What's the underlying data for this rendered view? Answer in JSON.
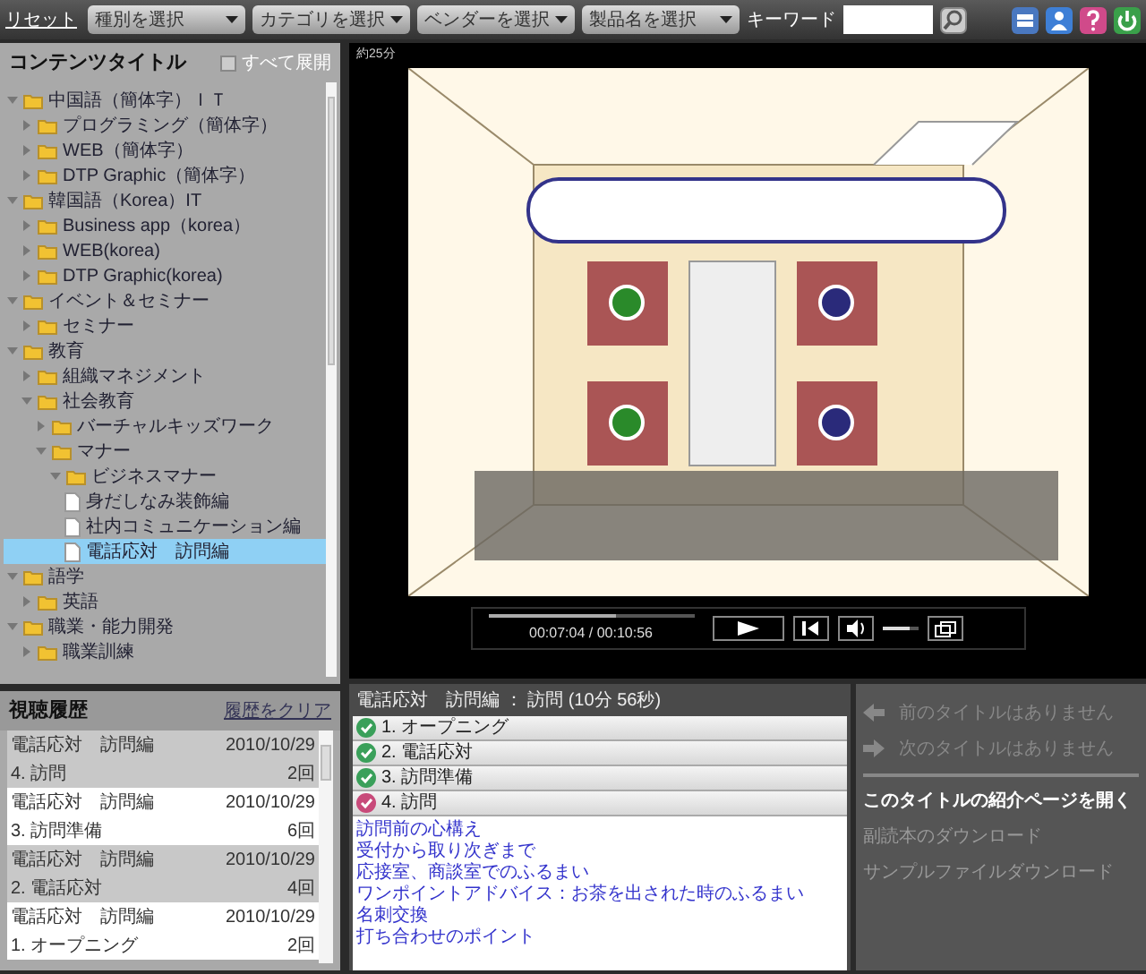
{
  "toolbar": {
    "reset": "リセット",
    "dropdowns": [
      "種別を選択",
      "カテゴリを選択",
      "ベンダーを選択",
      "製品名を選択"
    ],
    "keyword_label": "キーワード"
  },
  "content_panel": {
    "title": "コンテンツタイトル",
    "expand_all": {
      "label": "すべて展開",
      "checked": false
    },
    "tree": [
      {
        "label": "中国語（簡体字）ＩＴ",
        "kind": "folder",
        "expanded": true,
        "selected": false,
        "children": [
          {
            "label": "プログラミング（簡体字）",
            "kind": "folder",
            "expanded": false,
            "selected": false
          },
          {
            "label": "WEB（簡体字）",
            "kind": "folder",
            "expanded": false,
            "selected": false
          },
          {
            "label": "DTP Graphic（簡体字）",
            "kind": "folder",
            "expanded": false,
            "selected": false
          }
        ]
      },
      {
        "label": "韓国語（Korea）IT",
        "kind": "folder",
        "expanded": true,
        "selected": false,
        "children": [
          {
            "label": "Business app（korea）",
            "kind": "folder",
            "expanded": false,
            "selected": false
          },
          {
            "label": "WEB(korea)",
            "kind": "folder",
            "expanded": false,
            "selected": false
          },
          {
            "label": "DTP Graphic(korea)",
            "kind": "folder",
            "expanded": false,
            "selected": false
          }
        ]
      },
      {
        "label": "イベント＆セミナー",
        "kind": "folder",
        "expanded": true,
        "selected": false,
        "children": [
          {
            "label": "セミナー",
            "kind": "folder",
            "expanded": false,
            "selected": false
          }
        ]
      },
      {
        "label": "教育",
        "kind": "folder",
        "expanded": true,
        "selected": false,
        "children": [
          {
            "label": "組織マネジメント",
            "kind": "folder",
            "expanded": false,
            "selected": false
          },
          {
            "label": "社会教育",
            "kind": "folder",
            "expanded": true,
            "selected": false,
            "children": [
              {
                "label": "バーチャルキッズワーク",
                "kind": "folder",
                "expanded": false,
                "selected": false
              },
              {
                "label": "マナー",
                "kind": "folder",
                "expanded": true,
                "selected": false,
                "children": [
                  {
                    "label": "ビジネスマナー",
                    "kind": "folder",
                    "expanded": true,
                    "selected": false,
                    "children": [
                      {
                        "label": "身だしなみ装飾編",
                        "kind": "page",
                        "selected": false
                      },
                      {
                        "label": "社内コミュニケーション編",
                        "kind": "page",
                        "selected": false
                      },
                      {
                        "label": "電話応対　訪問編",
                        "kind": "page",
                        "selected": true
                      }
                    ]
                  }
                ]
              }
            ]
          }
        ]
      },
      {
        "label": "語学",
        "kind": "folder",
        "expanded": true,
        "selected": false,
        "children": [
          {
            "label": "英語",
            "kind": "folder",
            "expanded": false,
            "selected": false
          }
        ]
      },
      {
        "label": "職業・能力開発",
        "kind": "folder",
        "expanded": true,
        "selected": false,
        "children": [
          {
            "label": "職業訓練",
            "kind": "folder",
            "expanded": false,
            "selected": false
          }
        ]
      }
    ]
  },
  "history": {
    "title": "視聴履歴",
    "clear": "履歴をクリア",
    "rows": [
      {
        "title": "電話応対　訪問編",
        "date": "2010/10/29",
        "chapter": "4. 訪問",
        "count": "2回"
      },
      {
        "title": "電話応対　訪問編",
        "date": "2010/10/29",
        "chapter": "3. 訪問準備",
        "count": "6回"
      },
      {
        "title": "電話応対　訪問編",
        "date": "2010/10/29",
        "chapter": "2. 電話応対",
        "count": "4回"
      },
      {
        "title": "電話応対　訪問編",
        "date": "2010/10/29",
        "chapter": "1. オープニング",
        "count": "2回"
      }
    ]
  },
  "player": {
    "duration_note": "約25分",
    "seek": {
      "level": 0.62
    },
    "time": "00:07:04 / 00:10:56",
    "volume": {
      "level": 0.75
    }
  },
  "chapters": {
    "title": "電話応対　訪問編 ： 訪問 (10分 56秒)",
    "items": [
      {
        "label": "1. オープニング",
        "selected": false
      },
      {
        "label": "2. 電話応対",
        "selected": false
      },
      {
        "label": "3. 訪問準備",
        "selected": false
      },
      {
        "label": "4. 訪問",
        "selected": true
      }
    ],
    "topics": [
      "訪問前の心構え",
      "受付から取り次ぎまで",
      "応接室、商談室でのふるまい",
      "ワンポイントアドバイス：お茶を出された時のふるまい",
      "名刺交換",
      "打ち合わせのポイント"
    ]
  },
  "navigation": {
    "items": [
      {
        "label": "前のタイトルはありません",
        "kind": "prev",
        "disabled": true
      },
      {
        "label": "次のタイトルはありません",
        "kind": "next",
        "disabled": true
      }
    ],
    "links": [
      {
        "label": "このタイトルの紹介ページを開く",
        "disabled": false
      },
      {
        "label": "副読本のダウンロード",
        "disabled": true
      },
      {
        "label": "サンプルファイルダウンロード",
        "disabled": true
      }
    ]
  }
}
